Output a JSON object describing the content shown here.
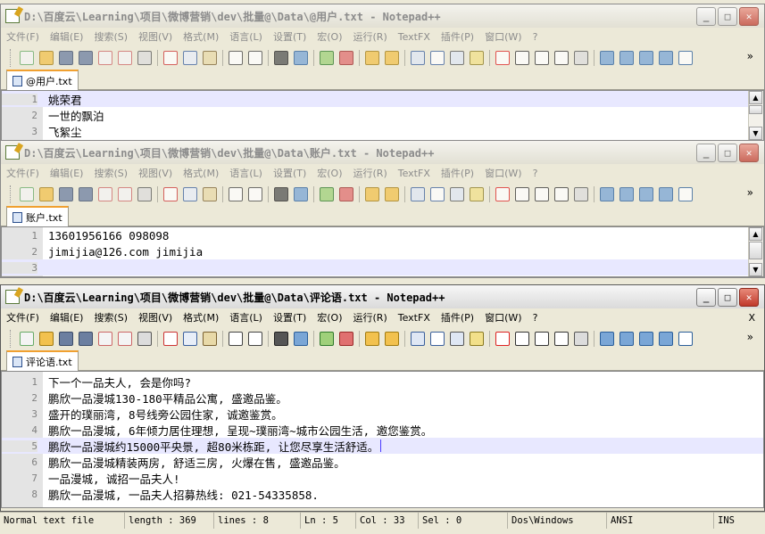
{
  "menu": [
    "文件(F)",
    "编辑(E)",
    "搜索(S)",
    "视图(V)",
    "格式(M)",
    "语言(L)",
    "设置(T)",
    "宏(O)",
    "运行(R)",
    "TextFX",
    "插件(P)",
    "窗口(W)",
    "?"
  ],
  "menu_close": "X",
  "toolbar_more": "»",
  "win1": {
    "title": "D:\\百度云\\Learning\\项目\\微博营销\\dev\\批量@\\Data\\@用户.txt - Notepad++",
    "tab": "@用户.txt",
    "lines": [
      {
        "num": "1",
        "text": "姚荣君"
      },
      {
        "num": "2",
        "text": "一世的飘泊"
      },
      {
        "num": "3",
        "text": "飞絮尘"
      }
    ]
  },
  "win2": {
    "title": "D:\\百度云\\Learning\\项目\\微博营销\\dev\\批量@\\Data\\账户.txt - Notepad++",
    "tab": "账户.txt",
    "lines": [
      {
        "num": "1",
        "text": "13601956166 098098"
      },
      {
        "num": "2",
        "text": "jimijia@126.com jimijia"
      },
      {
        "num": "3",
        "text": ""
      }
    ]
  },
  "win3": {
    "title": "D:\\百度云\\Learning\\项目\\微博营销\\dev\\批量@\\Data\\评论语.txt - Notepad++",
    "tab": "评论语.txt",
    "lines": [
      {
        "num": "1",
        "text": "下一个一品夫人, 会是你吗?"
      },
      {
        "num": "2",
        "text": "鹏欣一品漫城130-180平精品公寓, 盛邀品鉴。"
      },
      {
        "num": "3",
        "text": "盛开的璞丽湾, 8号线旁公园住家, 诚邀鉴赏。"
      },
      {
        "num": "4",
        "text": "鹏欣一品漫城, 6年倾力居住理想, 呈现~璞丽湾~城市公园生活, 邀您鉴赏。"
      },
      {
        "num": "5",
        "text": "鹏欣一品漫城约15000平央景, 超80米栋距, 让您尽享生活舒适。"
      },
      {
        "num": "6",
        "text": "鹏欣一品漫城精装两房, 舒适三房, 火爆在售, 盛邀品鉴。"
      },
      {
        "num": "7",
        "text": "一品漫城, 诚招一品夫人!"
      },
      {
        "num": "8",
        "text": "鹏欣一品漫城, 一品夫人招募热线: 021-54335858."
      }
    ]
  },
  "status": {
    "type": "Normal text file",
    "length": "length : 369",
    "lines": "lines : 8",
    "ln": "Ln : 5",
    "col": "Col : 33",
    "sel": "Sel : 0",
    "eol": "Dos\\Windows",
    "encoding": "ANSI",
    "mode": "INS"
  }
}
